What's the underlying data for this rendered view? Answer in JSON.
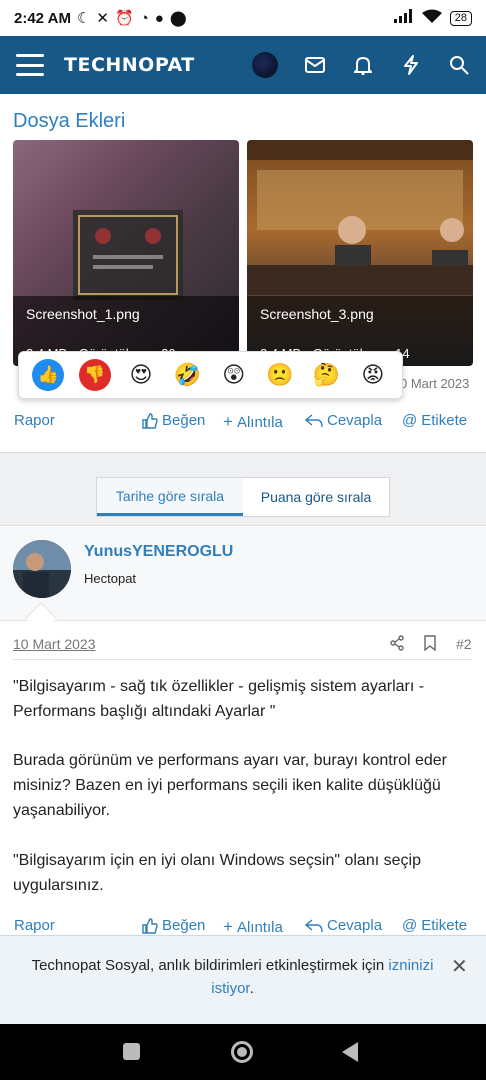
{
  "status_bar": {
    "time": "2:42 AM",
    "battery": "28"
  },
  "header": {
    "logo": "TECHNOPAT"
  },
  "attachments": {
    "title": "Dosya Ekleri",
    "items": [
      {
        "filename": "Screenshot_1.png",
        "meta": "2.4 MB · Görüntüleme: 20"
      },
      {
        "filename": "Screenshot_3.png",
        "meta": "2.4 MB · Görüntüleme: 14"
      }
    ]
  },
  "reactions": {
    "items": [
      {
        "icon": "like-reaction-icon",
        "glyph": "👍",
        "color": "#1e8cf0"
      },
      {
        "icon": "dislike-reaction-icon",
        "glyph": "👎",
        "color": "#e02b2b"
      },
      {
        "icon": "love-eyes-reaction-icon",
        "glyph": "😍"
      },
      {
        "icon": "laugh-reaction-icon",
        "glyph": "🤣"
      },
      {
        "icon": "wow-reaction-icon",
        "glyph": "😲"
      },
      {
        "icon": "sad-reaction-icon",
        "glyph": "🙁"
      },
      {
        "icon": "thinking-reaction-icon",
        "glyph": "🤔"
      },
      {
        "icon": "angry-reaction-icon",
        "glyph": "😡"
      }
    ],
    "partial_date": "0 Mart 2023"
  },
  "actions_top": {
    "report": "Rapor",
    "like": "Beğen",
    "quote": "Alıntıla",
    "reply": "Cevapla",
    "tag": "Etikete"
  },
  "sort": {
    "tab1": "Tarihe göre sırala",
    "tab2": "Puana göre sırala"
  },
  "post": {
    "username": "YunusYENEROGLU",
    "user_title": "Hectopat",
    "date": "10 Mart 2023",
    "number": "#2",
    "para1": "\"Bilgisayarım - sağ tık özellikler - gelişmiş sistem ayarları - Performans başlığı altındaki Ayarlar \"",
    "para2": "Burada görünüm ve performans ayarı var, burayı kontrol eder misiniz? Bazen en iyi performans seçili iken kalite düşüklüğü yaşanabiliyor.",
    "para3": "\"Bilgisayarım için en iyi olanı Windows seçsin\" olanı seçip uygularsınız."
  },
  "actions_bottom": {
    "report": "Rapor",
    "like": "Beğen",
    "quote": "Alıntıla",
    "reply": "Cevapla",
    "tag": "Etikete"
  },
  "notification": {
    "text": "Technopat Sosyal, anlık bildirimleri etkinleştirmek için ",
    "link": "izninizi istiyor",
    "end": "."
  },
  "colors": {
    "header_bg": "#185886",
    "accent": "#2f7fbd"
  }
}
